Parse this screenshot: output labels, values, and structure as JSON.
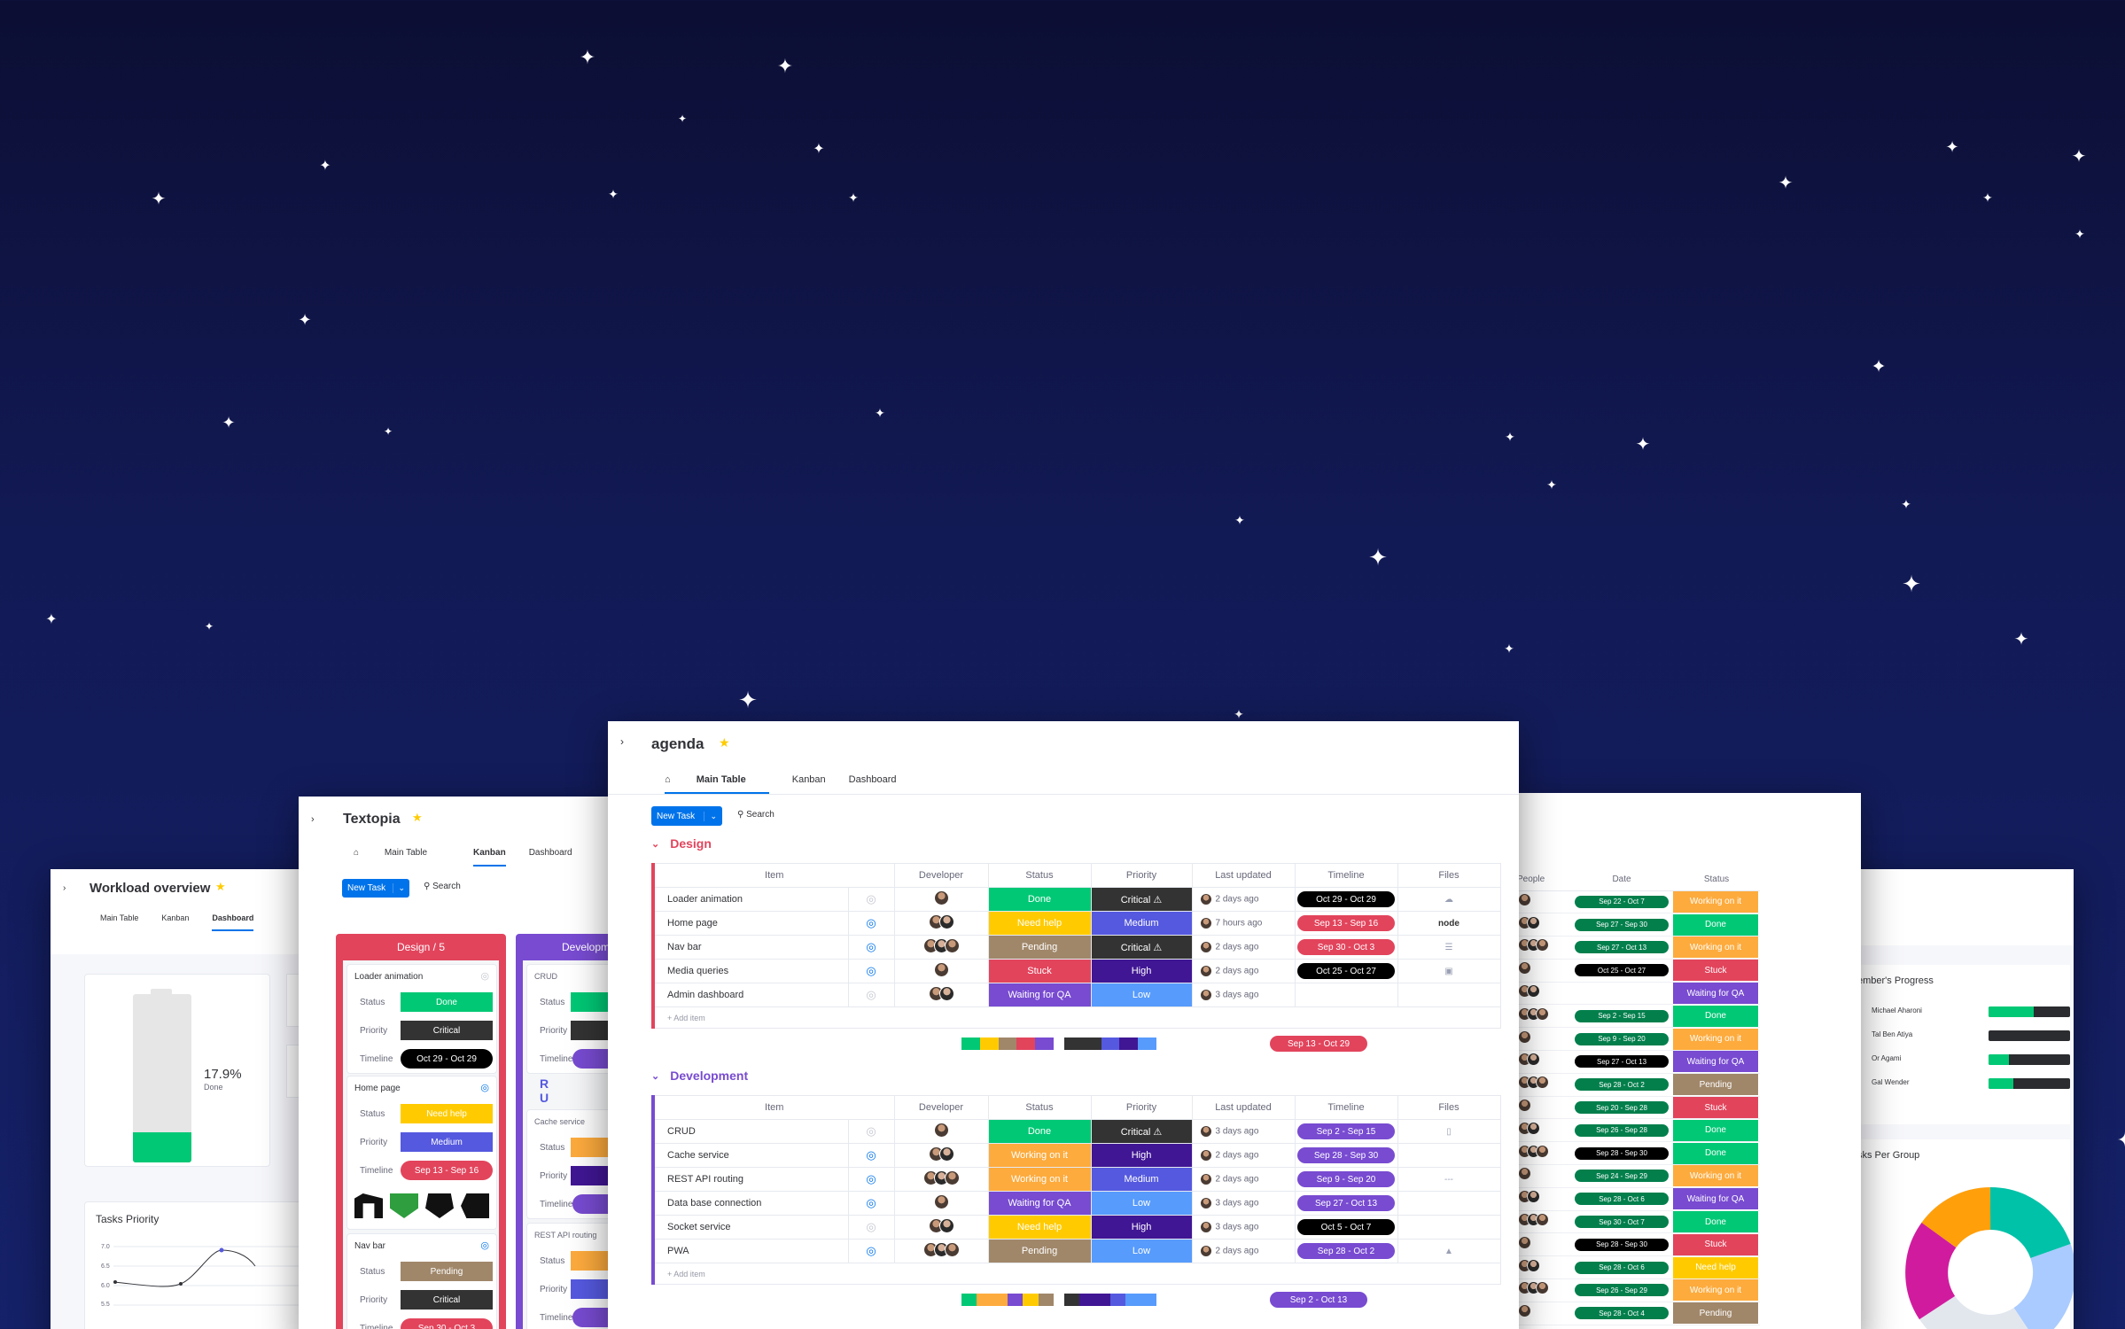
{
  "colors": {
    "done": "#00c875",
    "working": "#fdab3d",
    "stuck": "#e2445c",
    "pending": "#a0876a",
    "waiting": "#784bd1",
    "needhelp": "#ffcb00",
    "critical": "#333333",
    "high": "#401694",
    "medium": "#5559df",
    "low": "#579bfc",
    "timeline_dark": "#000000",
    "timeline_red": "#e2445c",
    "timeline_purple": "#784bd1",
    "brand": "#0073ea",
    "design": "#e2445c",
    "development": "#784bd1"
  },
  "workload": {
    "title": "Workload overview",
    "tabs": [
      "Main Table",
      "Kanban",
      "Dashboard"
    ],
    "battery_value": "17.9%",
    "battery_label": "Done",
    "battery_done_fraction": 0.179,
    "tasks_priority_title": "Tasks Priority",
    "y_ticks": [
      "7.0",
      "6.5",
      "6.0",
      "5.5"
    ]
  },
  "textopia": {
    "title": "Textopia",
    "tabs": [
      "Main Table",
      "Kanban",
      "Dashboard"
    ],
    "new_task": "New Task",
    "search": "Search",
    "col1_title": "Design / 5",
    "col2_title": "Developm",
    "labels": {
      "status": "Status",
      "priority": "Priority",
      "timeline": "Timeline"
    },
    "cards": [
      {
        "name": "Loader animation",
        "status": "Done",
        "priority": "Critical",
        "timeline": "Oct 29 - Oct 29"
      },
      {
        "name": "Home page",
        "status": "Need help",
        "priority": "Medium",
        "timeline": "Sep 13 - Sep 16"
      },
      {
        "name": "Nav bar",
        "status": "Pending",
        "priority": "Critical",
        "timeline": "Sep 30 - Oct 3"
      }
    ],
    "dev_cards": [
      "CRUD",
      "Cache service",
      "REST API routing"
    ]
  },
  "agenda": {
    "title": "agenda",
    "tabs": [
      "Main Table",
      "Kanban",
      "Dashboard"
    ],
    "new_task": "New Task",
    "search": "Search",
    "columns": [
      "Item",
      "Developer",
      "Status",
      "Priority",
      "Last updated",
      "Timeline",
      "Files"
    ],
    "add_item": "+ Add item",
    "groups": [
      {
        "name": "Design",
        "summary_timeline": "Sep 13 - Oct 29",
        "rows": [
          {
            "item": "Loader animation",
            "status": "Done",
            "status_color": "done",
            "priority": "Critical ⚠",
            "priority_color": "critical",
            "updated": "2 days ago",
            "timeline": "Oct 29 - Oct 29",
            "tl_color": "timeline_dark",
            "file": "cloud"
          },
          {
            "item": "Home page",
            "status": "Need help",
            "status_color": "needhelp",
            "priority": "Medium",
            "priority_color": "medium",
            "updated": "7 hours ago",
            "timeline": "Sep 13 - Sep 16",
            "tl_color": "timeline_red",
            "file": "node"
          },
          {
            "item": "Nav bar",
            "status": "Pending",
            "status_color": "pending",
            "priority": "Critical ⚠",
            "priority_color": "critical",
            "updated": "2 days ago",
            "timeline": "Sep 30 - Oct 3",
            "tl_color": "timeline_red",
            "file": "lines"
          },
          {
            "item": "Media queries",
            "status": "Stuck",
            "status_color": "stuck",
            "priority": "High",
            "priority_color": "high",
            "updated": "2 days ago",
            "timeline": "Oct 25 - Oct 27",
            "tl_color": "timeline_dark",
            "file": "img"
          },
          {
            "item": "Admin dashboard",
            "status": "Waiting for QA",
            "status_color": "waiting",
            "priority": "Low",
            "priority_color": "low",
            "updated": "3 days ago",
            "timeline": "",
            "tl_color": "",
            "file": ""
          }
        ]
      },
      {
        "name": "Development",
        "summary_timeline": "Sep 2 - Oct 13",
        "rows": [
          {
            "item": "CRUD",
            "status": "Done",
            "status_color": "done",
            "priority": "Critical ⚠",
            "priority_color": "critical",
            "updated": "3 days ago",
            "timeline": "Sep 2 - Sep 15",
            "tl_color": "timeline_purple",
            "file": "doc"
          },
          {
            "item": "Cache service",
            "status": "Working on it",
            "status_color": "working",
            "priority": "High",
            "priority_color": "high",
            "updated": "2 days ago",
            "timeline": "Sep 28 - Sep 30",
            "tl_color": "timeline_purple",
            "file": ""
          },
          {
            "item": "REST API routing",
            "status": "Working on it",
            "status_color": "working",
            "priority": "Medium",
            "priority_color": "medium",
            "updated": "2 days ago",
            "timeline": "Sep 9 - Sep 20",
            "tl_color": "timeline_purple",
            "file": "dash"
          },
          {
            "item": "Data base connection",
            "status": "Waiting for QA",
            "status_color": "waiting",
            "priority": "Low",
            "priority_color": "low",
            "updated": "3 days ago",
            "timeline": "Sep 27 - Oct 13",
            "tl_color": "timeline_purple",
            "file": ""
          },
          {
            "item": "Socket service",
            "status": "Need help",
            "status_color": "needhelp",
            "priority": "High",
            "priority_color": "high",
            "updated": "3 days ago",
            "timeline": "Oct 5 - Oct 7",
            "tl_color": "timeline_dark",
            "file": ""
          },
          {
            "item": "PWA",
            "status": "Pending",
            "status_color": "pending",
            "priority": "Low",
            "priority_color": "low",
            "updated": "2 days ago",
            "timeline": "Sep 28 - Oct 2",
            "tl_color": "timeline_purple",
            "file": "map"
          }
        ]
      }
    ]
  },
  "people_panel": {
    "columns": [
      "People",
      "Date",
      "Status"
    ],
    "rows": [
      {
        "date": "Sep 22 - Oct 7",
        "status": "Working on it",
        "sc": "working"
      },
      {
        "date": "Sep 27 - Sep 30",
        "status": "Done",
        "sc": "done"
      },
      {
        "date": "Sep 27 - Oct 13",
        "status": "Working on it",
        "sc": "working"
      },
      {
        "date": "Oct 25 - Oct 27",
        "status": "Stuck",
        "sc": "stuck"
      },
      {
        "date": "",
        "status": "Waiting for QA",
        "sc": "waiting"
      },
      {
        "date": "Sep 2 - Sep 15",
        "status": "Done",
        "sc": "done"
      },
      {
        "date": "Sep 9 - Sep 20",
        "status": "Working on it",
        "sc": "working"
      },
      {
        "date": "Sep 27 - Oct 13",
        "status": "Waiting for QA",
        "sc": "waiting"
      },
      {
        "date": "Sep 28 - Oct 2",
        "status": "Pending",
        "sc": "pending"
      },
      {
        "date": "Sep 20 - Sep 28",
        "status": "Stuck",
        "sc": "stuck"
      },
      {
        "date": "Sep 26 - Sep 28",
        "status": "Done",
        "sc": "done"
      },
      {
        "date": "Sep 28 - Sep 30",
        "status": "Done",
        "sc": "done"
      },
      {
        "date": "Sep 24 - Sep 29",
        "status": "Working on it",
        "sc": "working"
      },
      {
        "date": "Sep 28 - Oct 6",
        "status": "Waiting for QA",
        "sc": "waiting"
      },
      {
        "date": "Sep 30 - Oct 7",
        "status": "Done",
        "sc": "done"
      },
      {
        "date": "Sep 28 - Sep 30",
        "status": "Stuck",
        "sc": "stuck"
      },
      {
        "date": "Sep 28 - Oct 6",
        "status": "Need help",
        "sc": "needhelp"
      },
      {
        "date": "Sep 26 - Sep 29",
        "status": "Working on it",
        "sc": "working"
      },
      {
        "date": "Sep 28 - Oct 4",
        "status": "Pending",
        "sc": "pending"
      }
    ]
  },
  "progress_panel": {
    "title": "ember's Progress",
    "members": [
      {
        "name": "Michael Aharoni",
        "progress": 0.55
      },
      {
        "name": "Tal Ben Atiya",
        "progress": 0.0
      },
      {
        "name": "Or Agami",
        "progress": 0.25
      },
      {
        "name": "Gal Wender",
        "progress": 0.3
      }
    ],
    "group_title": "sks Per Group"
  }
}
